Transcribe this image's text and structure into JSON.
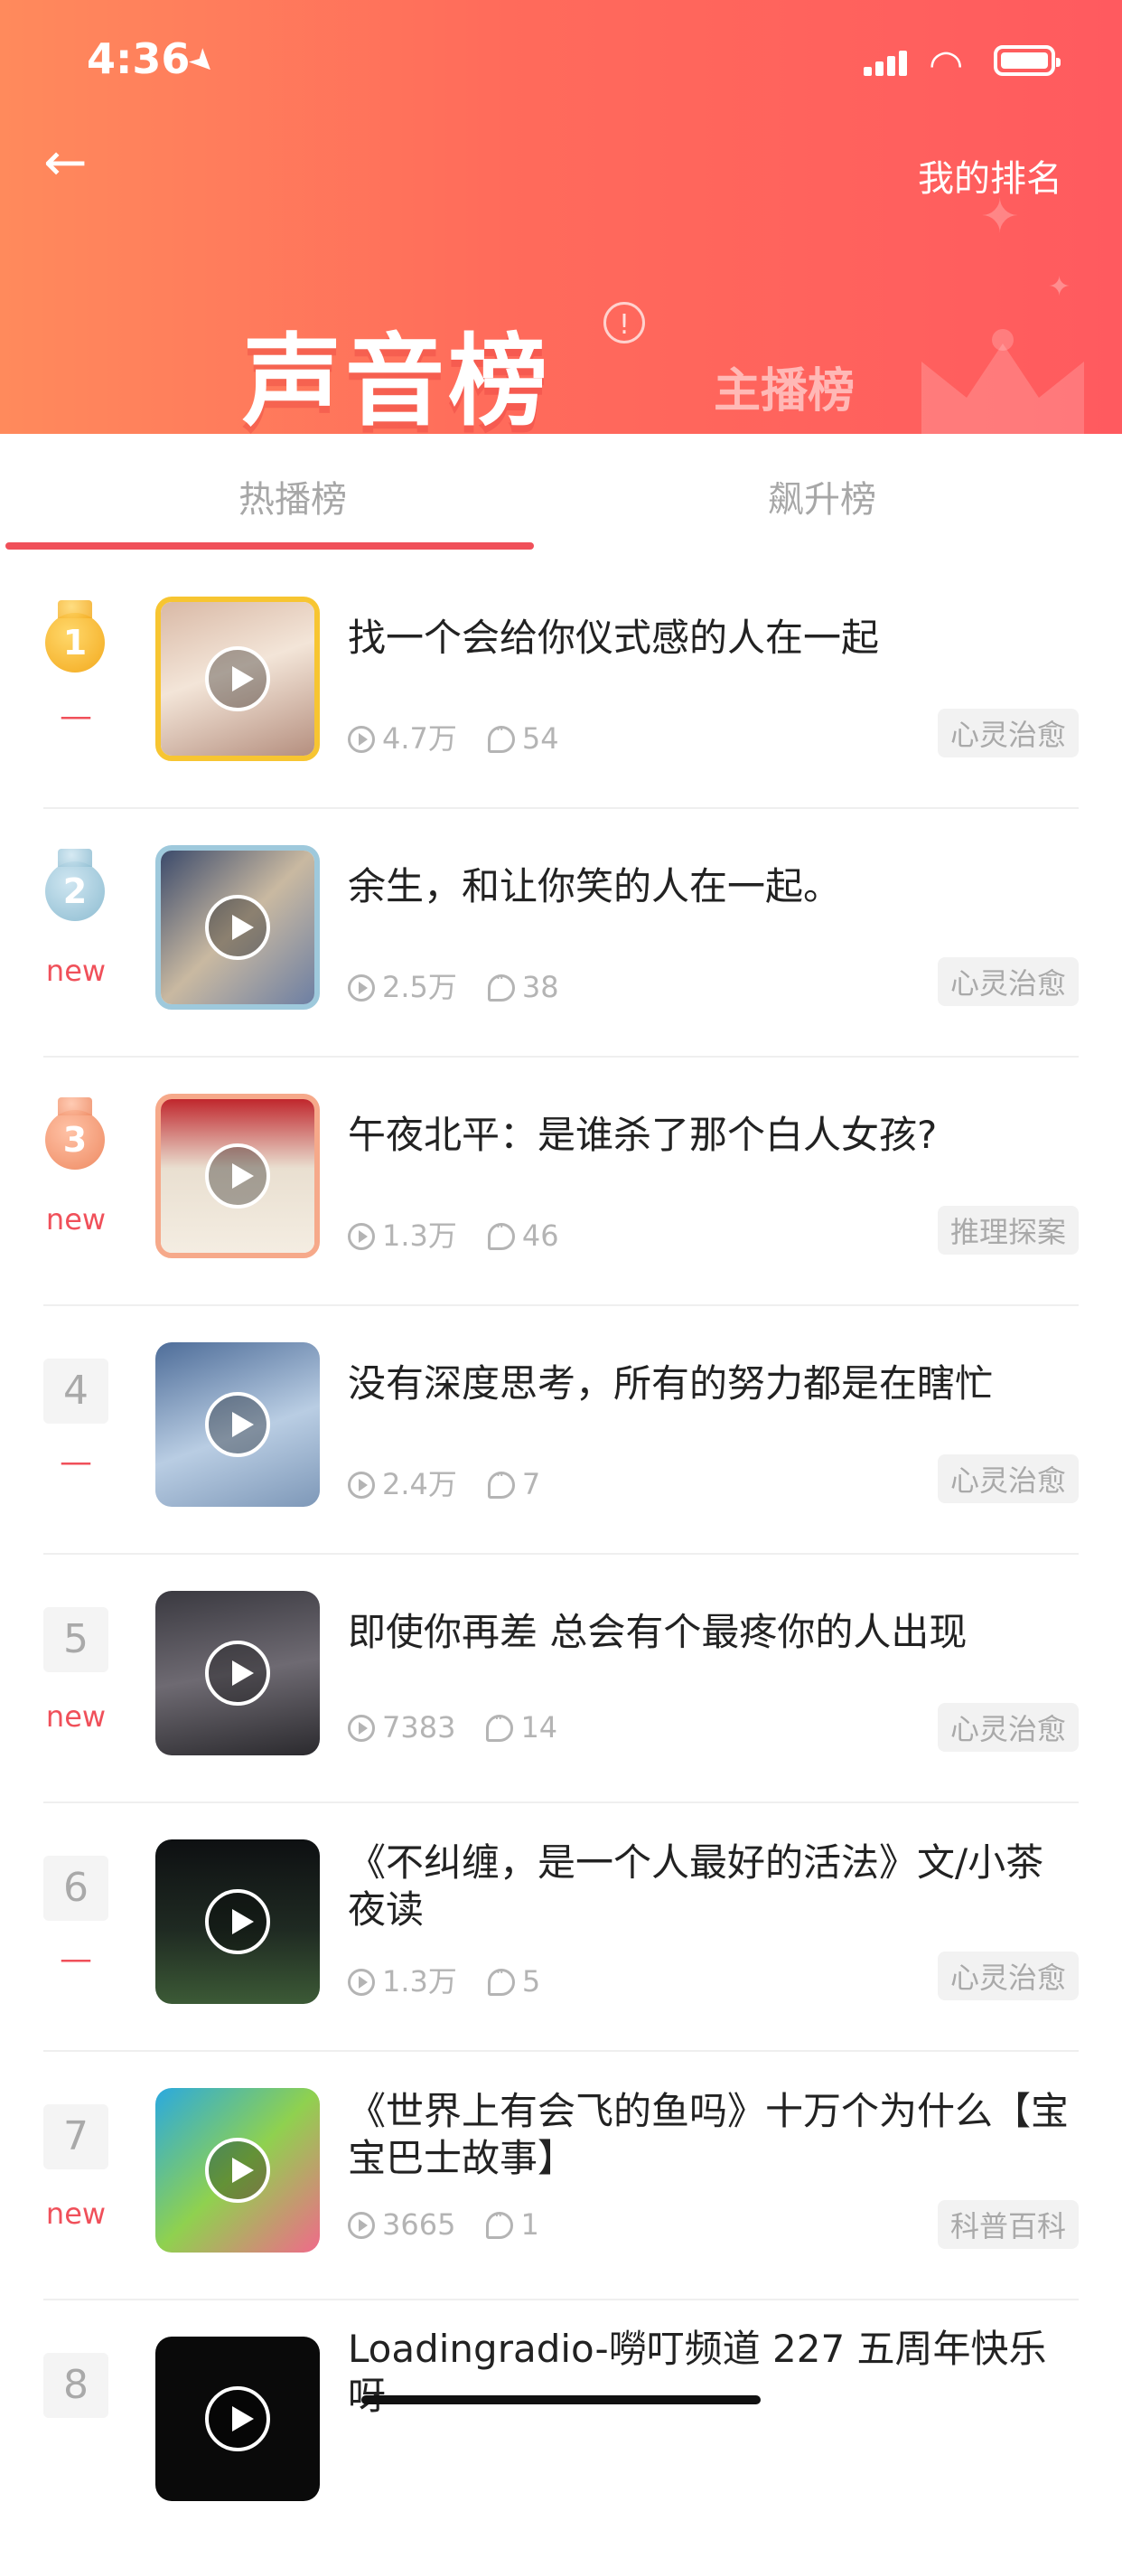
{
  "status_bar": {
    "time": "4:36"
  },
  "header": {
    "my_rank": "我的排名",
    "title": "声音榜",
    "anchor_tab": "主播榜"
  },
  "tabs": [
    {
      "label": "热播榜",
      "active": true
    },
    {
      "label": "飙升榜",
      "active": false
    }
  ],
  "accent_color": "#f0505a",
  "items": [
    {
      "rank": "1",
      "medal": "gold",
      "trend": "—",
      "title": "找一个会给你仪式感的人在一起",
      "plays": "4.7万",
      "comments": "54",
      "tag": "心灵治愈"
    },
    {
      "rank": "2",
      "medal": "silver",
      "trend": "new",
      "title": "余生，和让你笑的人在一起。",
      "plays": "2.5万",
      "comments": "38",
      "tag": "心灵治愈"
    },
    {
      "rank": "3",
      "medal": "bronze",
      "trend": "new",
      "title": "午夜北平：是谁杀了那个白人女孩?",
      "plays": "1.3万",
      "comments": "46",
      "tag": "推理探案"
    },
    {
      "rank": "4",
      "medal": "",
      "trend": "—",
      "title": "没有深度思考，所有的努力都是在瞎忙",
      "plays": "2.4万",
      "comments": "7",
      "tag": "心灵治愈"
    },
    {
      "rank": "5",
      "medal": "",
      "trend": "new",
      "title": "即使你再差 总会有个最疼你的人出现",
      "plays": "7383",
      "comments": "14",
      "tag": "心灵治愈"
    },
    {
      "rank": "6",
      "medal": "",
      "trend": "—",
      "title": "《不纠缠，是一个人最好的活法》文/小茶夜读",
      "plays": "1.3万",
      "comments": "5",
      "tag": "心灵治愈"
    },
    {
      "rank": "7",
      "medal": "",
      "trend": "new",
      "title": "《世界上有会飞的鱼吗》十万个为什么【宝宝巴士故事】",
      "plays": "3665",
      "comments": "1",
      "tag": "科普百科"
    },
    {
      "rank": "8",
      "medal": "",
      "trend": "",
      "title": "Loadingradio-嘮叮频道 227 五周年快乐呀",
      "plays": "",
      "comments": "",
      "tag": ""
    }
  ]
}
